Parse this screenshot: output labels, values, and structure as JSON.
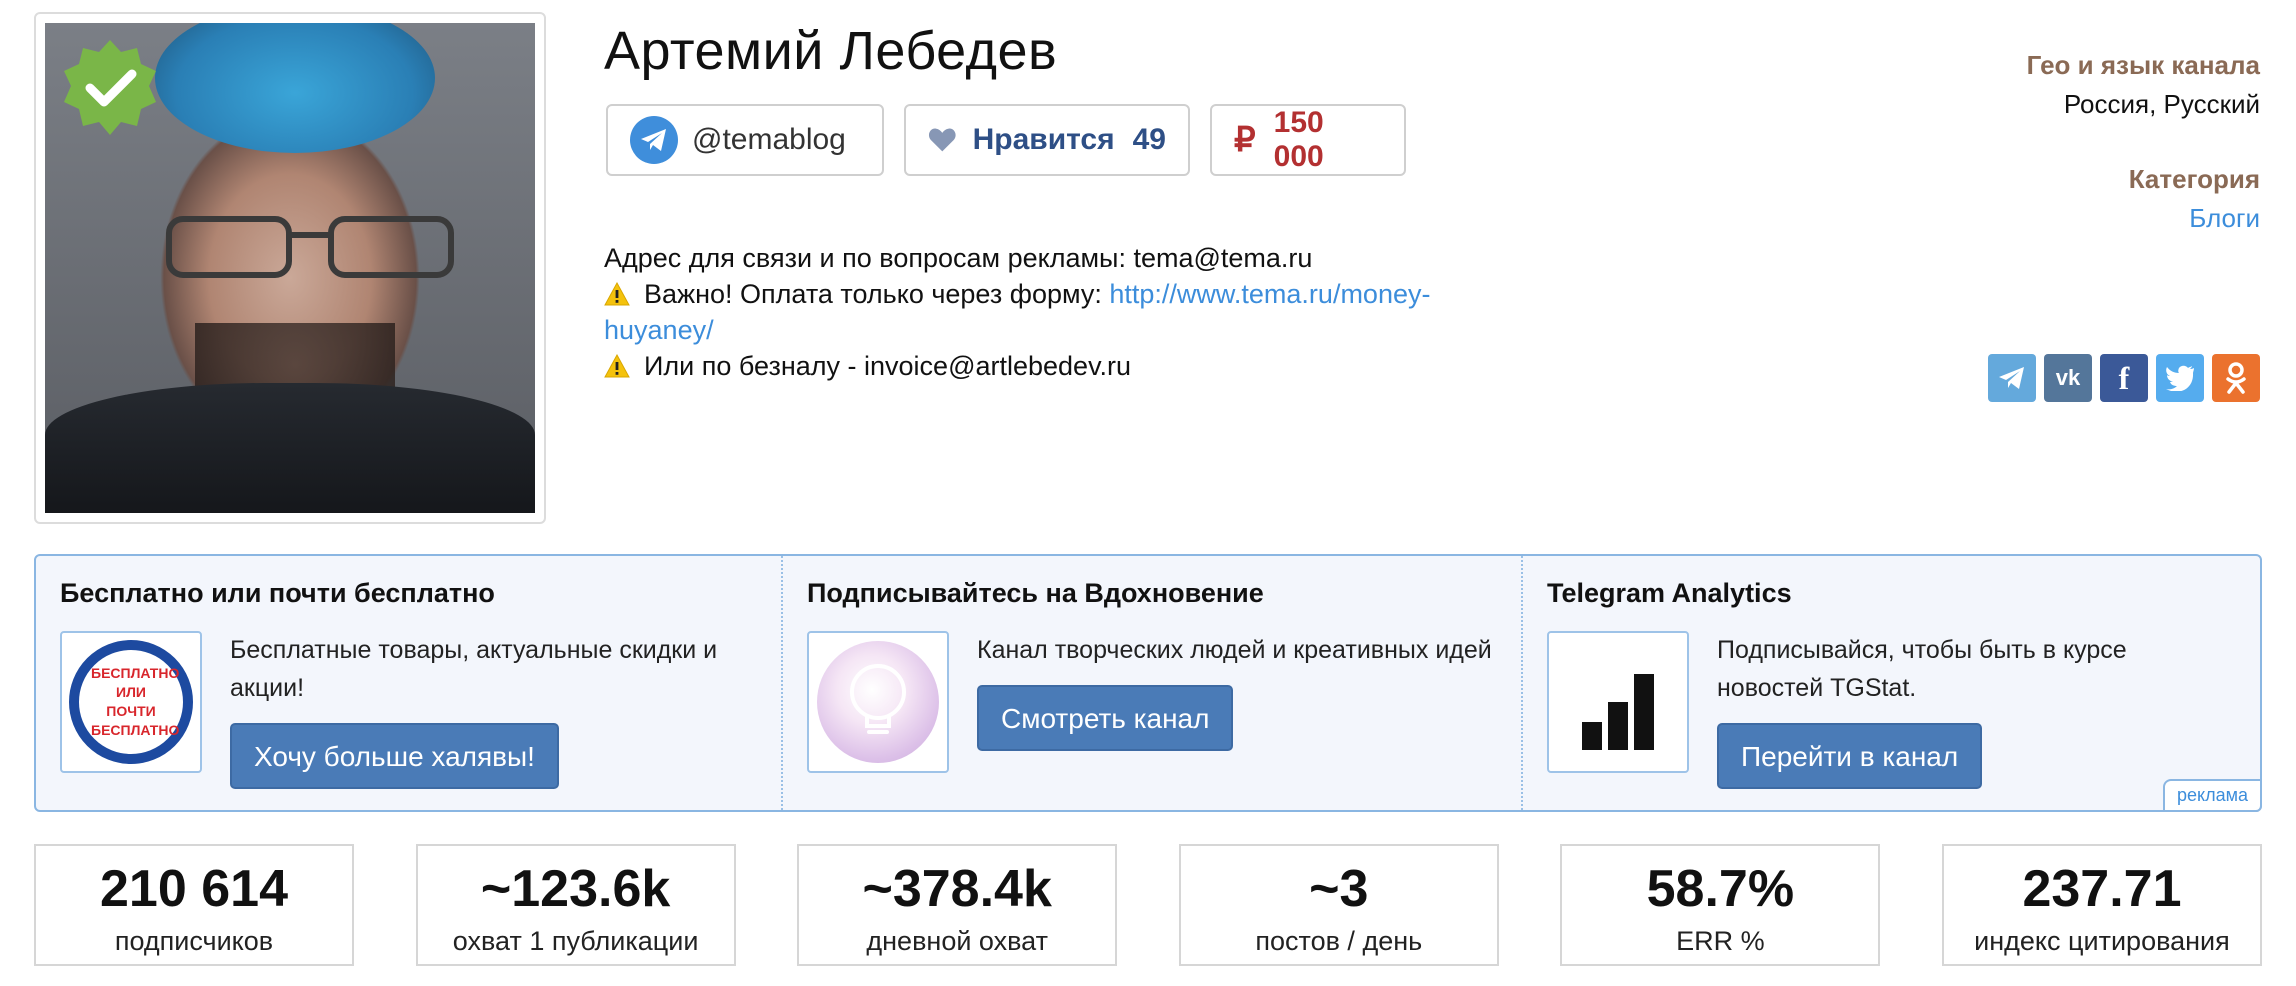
{
  "channel": {
    "title": "Артемий Лебедев",
    "username": "@temablog",
    "like_label": "Нравится",
    "like_count": "49",
    "price": "150 000",
    "description": {
      "line1": "Адрес для связи и по вопросам рекламы: tema@tema.ru",
      "line2_prefix": "Важно! Оплата только через форму: ",
      "line2_link": "http://www.tema.ru/money-huyaney/",
      "line3": "Или по безналу - invoice@artlebedev.ru"
    }
  },
  "meta": {
    "geo_label": "Гео и язык канала",
    "geo_value": "Россия, Русский",
    "category_label": "Категория",
    "category_value": "Блоги"
  },
  "socials": [
    "telegram-icon",
    "vk-icon",
    "facebook-icon",
    "twitter-icon",
    "odnoklassniki-icon"
  ],
  "colors": {
    "accent": "#4a7bb7",
    "link": "#3c8ddb",
    "price": "#b33031",
    "like": "#2e4f86",
    "meta_label": "#8a6a55",
    "verified": "#7ab648"
  },
  "ads": {
    "items": [
      {
        "title": "Бесплатно или почти бесплатно",
        "text": "Бесплатные товары, актуальные скидки и акции!",
        "button": "Хочу больше халявы!",
        "logo_text": "БЕСПЛАТНО ИЛИ ПОЧТИ БЕСПЛАТНО"
      },
      {
        "title": "Подписывайтесь на Вдохновение",
        "text": "Канал творческих людей и креативных идей",
        "button": "Смотреть канал"
      },
      {
        "title": "Telegram Analytics",
        "text": "Подписывайся, чтобы быть в курсе новостей TGStat.",
        "button": "Перейти в канал"
      }
    ],
    "label": "реклама"
  },
  "stats": [
    {
      "value": "210 614",
      "label": "подписчиков"
    },
    {
      "value": "~123.6k",
      "label": "охват 1 публикации"
    },
    {
      "value": "~378.4k",
      "label": "дневной охват"
    },
    {
      "value": "~3",
      "label": "постов / день"
    },
    {
      "value": "58.7%",
      "label": "ERR %"
    },
    {
      "value": "237.71",
      "label": "индекс цитирования"
    }
  ]
}
